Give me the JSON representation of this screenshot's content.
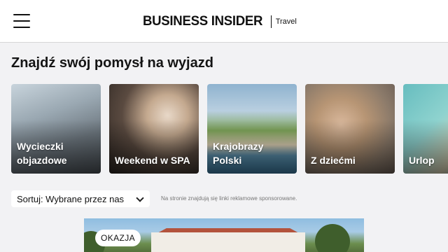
{
  "header": {
    "menu_icon": "hamburger-menu-icon",
    "brand": "BUSINESS INSIDER",
    "section": "Travel"
  },
  "main": {
    "heading": "Znajdź swój pomysł na wyjazd",
    "categories": [
      {
        "label": "Wycieczki objazdowe"
      },
      {
        "label": "Weekend w SPA"
      },
      {
        "label": "Krajobrazy Polski"
      },
      {
        "label": "Z dziećmi"
      },
      {
        "label": "Urlop"
      }
    ],
    "sort": {
      "label": "Sortuj: Wybrane przez nas",
      "icon": "chevron-down-icon"
    },
    "notice": "Na stronie znajdują się linki reklamowe sponsorowane.",
    "featured": {
      "badge": "OKAZJA"
    }
  }
}
